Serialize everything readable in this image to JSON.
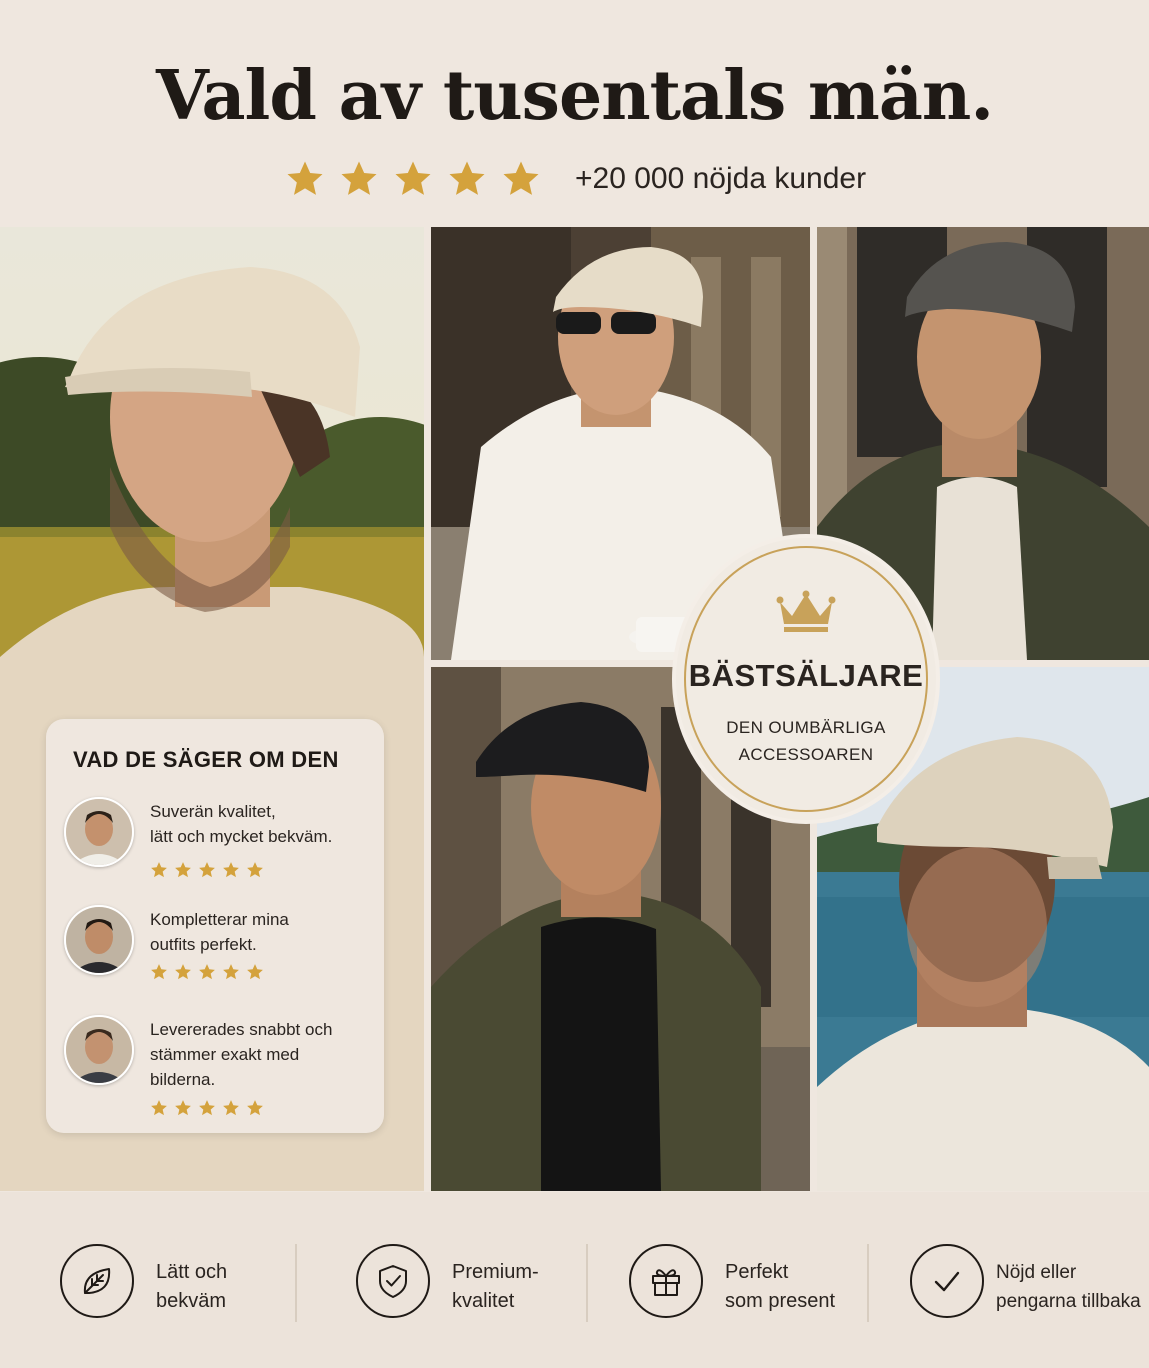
{
  "header": {
    "title": "Vald av tusentals män.",
    "rating_text": "+20 000 nöjda kunder",
    "star_color": "#d4a23c"
  },
  "photos": [
    {
      "name": "man in beige flat cap in field",
      "cap_color": "#e8dcc6"
    },
    {
      "name": "man in beige flat cap with coffee",
      "cap_color": "#e6dcc8"
    },
    {
      "name": "man in grey flat cap",
      "cap_color": "#55534f"
    },
    {
      "name": "man in black flat cap",
      "cap_color": "#1c1c1e"
    },
    {
      "name": "man in beige flat cap by sea",
      "cap_color": "#ddd2bd"
    }
  ],
  "reviews": {
    "title": "VAD DE SÄGER OM DEN",
    "items": [
      {
        "text_line1": "Suverän kvalitet,",
        "text_line2": "lätt och mycket bekväm.",
        "text_line3": "",
        "stars": 5
      },
      {
        "text_line1": "Kompletterar mina",
        "text_line2": "outfits perfekt.",
        "text_line3": "",
        "stars": 5
      },
      {
        "text_line1": "Levererades snabbt och",
        "text_line2": "stämmer exakt med",
        "text_line3": "bilderna.",
        "stars": 5
      }
    ]
  },
  "badge": {
    "title": "BÄSTSÄLJARE",
    "subtitle_line1": "DEN OUMBÄRLIGA",
    "subtitle_line2": "ACCESSOAREN",
    "icon": "crown-icon",
    "accent": "#c8a25a"
  },
  "features": [
    {
      "icon": "leaf-icon",
      "line1": "Lätt och",
      "line2": "bekväm"
    },
    {
      "icon": "shield-check-icon",
      "line1": "Premium-",
      "line2": "kvalitet"
    },
    {
      "icon": "gift-icon",
      "line1": "Perfekt",
      "line2": "som present"
    },
    {
      "icon": "checkmark-icon",
      "line1": "Nöjd eller",
      "line2": "pengarna tillbaka"
    }
  ]
}
